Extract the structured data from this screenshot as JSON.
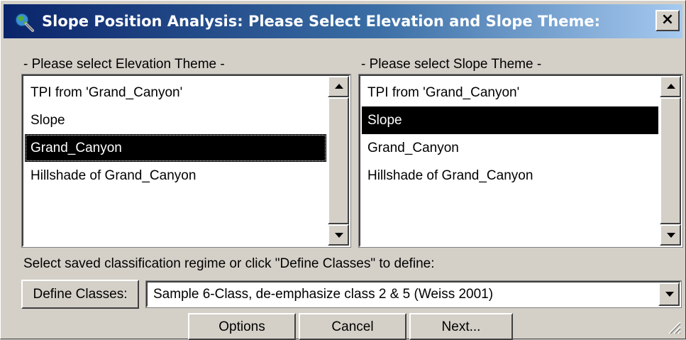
{
  "window": {
    "title": "Slope Position Analysis:  Please Select Elevation and Slope Theme:",
    "close_label": "×"
  },
  "elevation": {
    "heading": "- Please select Elevation Theme -",
    "items": [
      {
        "label": "TPI from 'Grand_Canyon'",
        "selected": false
      },
      {
        "label": "Slope",
        "selected": false
      },
      {
        "label": "Grand_Canyon",
        "selected": true
      },
      {
        "label": "Hillshade of Grand_Canyon",
        "selected": false
      }
    ]
  },
  "slope": {
    "heading": "- Please select Slope Theme -",
    "items": [
      {
        "label": "TPI from 'Grand_Canyon'",
        "selected": false
      },
      {
        "label": "Slope",
        "selected": true
      },
      {
        "label": "Grand_Canyon",
        "selected": false
      },
      {
        "label": "Hillshade of Grand_Canyon",
        "selected": false
      }
    ]
  },
  "classification": {
    "instruction": "Select saved classification regime or click \"Define Classes\" to define:",
    "define_button": "Define Classes:",
    "selected_regime": "Sample 6-Class, de-emphasize class 2 & 5 (Weiss 2001)"
  },
  "footer": {
    "options_label": "Options",
    "cancel_label": "Cancel",
    "next_label": "Next..."
  },
  "colors": {
    "title_gradient_start": "#0a246a",
    "title_gradient_end": "#a6caf0",
    "dialog_face": "#d4d0c8",
    "selection": "#000000"
  }
}
